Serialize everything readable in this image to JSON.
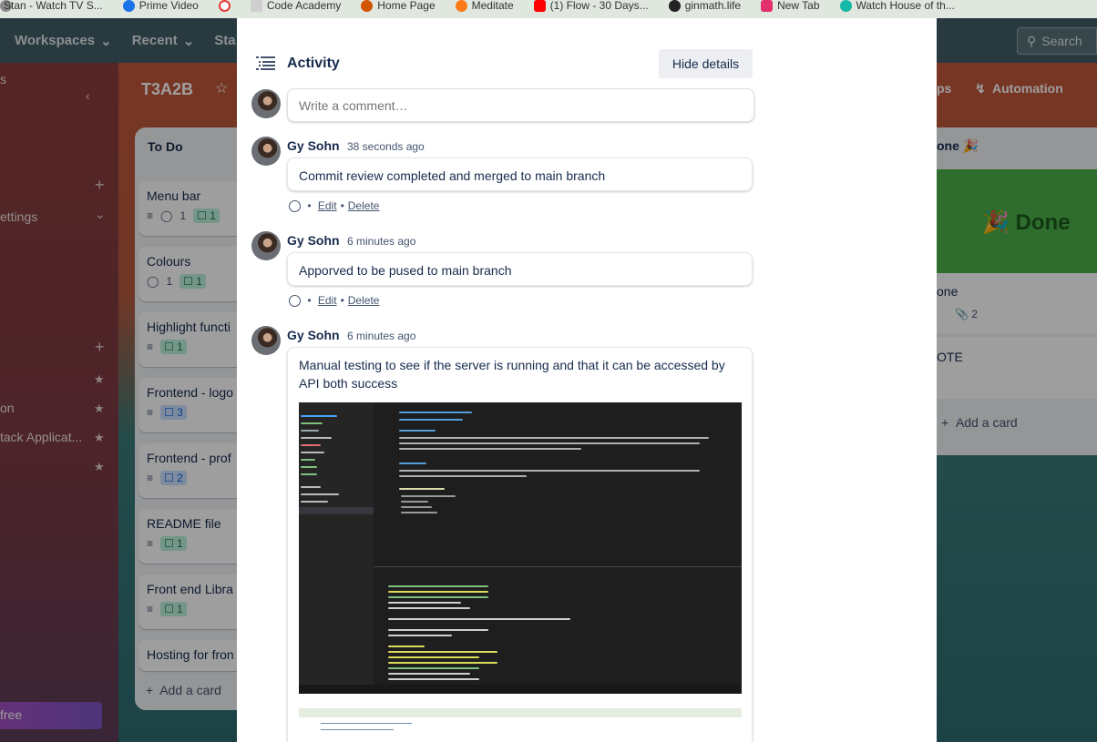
{
  "bookmarks": [
    {
      "label": "Stan - Watch TV S...",
      "color": "#8a8a8a"
    },
    {
      "label": "Prime Video",
      "color": "#1a73e8"
    },
    {
      "label": "",
      "color": "#e53935"
    },
    {
      "label": "Code Academy",
      "color": "#cfcfcf"
    },
    {
      "label": "Home Page",
      "color": "#d35400"
    },
    {
      "label": "Meditate",
      "color": "#ff7a1a"
    },
    {
      "label": "(1) Flow - 30 Days...",
      "color": "#ff0000"
    },
    {
      "label": "ginmath.life",
      "color": "#222222"
    },
    {
      "label": "New Tab",
      "color": "#e1306c"
    },
    {
      "label": "Watch House of th...",
      "color": "#14b8a6"
    }
  ],
  "topnav": {
    "workspaces": "Workspaces",
    "recent": "Recent",
    "starred_partial": "Sta",
    "search": "Search"
  },
  "sidebar": {
    "items": [
      "s",
      "ettings",
      "on",
      "tack Applicat...",
      "free"
    ]
  },
  "board": {
    "title": "T3A2B",
    "list_title": "To Do",
    "cards": [
      {
        "title": "Menu bar",
        "comments": "1",
        "checklist": "1"
      },
      {
        "title": "Colours",
        "comments": "1",
        "checklist": "1"
      },
      {
        "title": "Highlight functi",
        "checklist": "1"
      },
      {
        "title": "Frontend - logo",
        "checklist": "3"
      },
      {
        "title": "Frontend - prof",
        "checklist": "2"
      },
      {
        "title": "README file",
        "checklist": "1"
      },
      {
        "title": "Front end Libra",
        "checklist": "1"
      },
      {
        "title": "Hosting for fron"
      }
    ],
    "add_card": "Add a card",
    "right": {
      "ps": "ps",
      "automation": "Automation",
      "list_title": "one 🎉",
      "cover_text": "🎉 Done",
      "card1_title": "one",
      "card1_attach": "2",
      "card2_title": "OTE",
      "add_card": "Add a card"
    }
  },
  "activity": {
    "title": "Activity",
    "hide_details": "Hide details",
    "comment_placeholder": "Write a comment…",
    "comments": [
      {
        "author": "Gy Sohn",
        "time": "38 seconds ago",
        "text": "Commit review completed and merged to main branch",
        "edit": "Edit",
        "delete": "Delete"
      },
      {
        "author": "Gy Sohn",
        "time": "6 minutes ago",
        "text": "Apporved to be pused to main branch",
        "edit": "Edit",
        "delete": "Delete"
      },
      {
        "author": "Gy Sohn",
        "time": "6 minutes ago",
        "text": "Manual testing to see if the server is running and that it can be accessed by API both success"
      }
    ]
  }
}
